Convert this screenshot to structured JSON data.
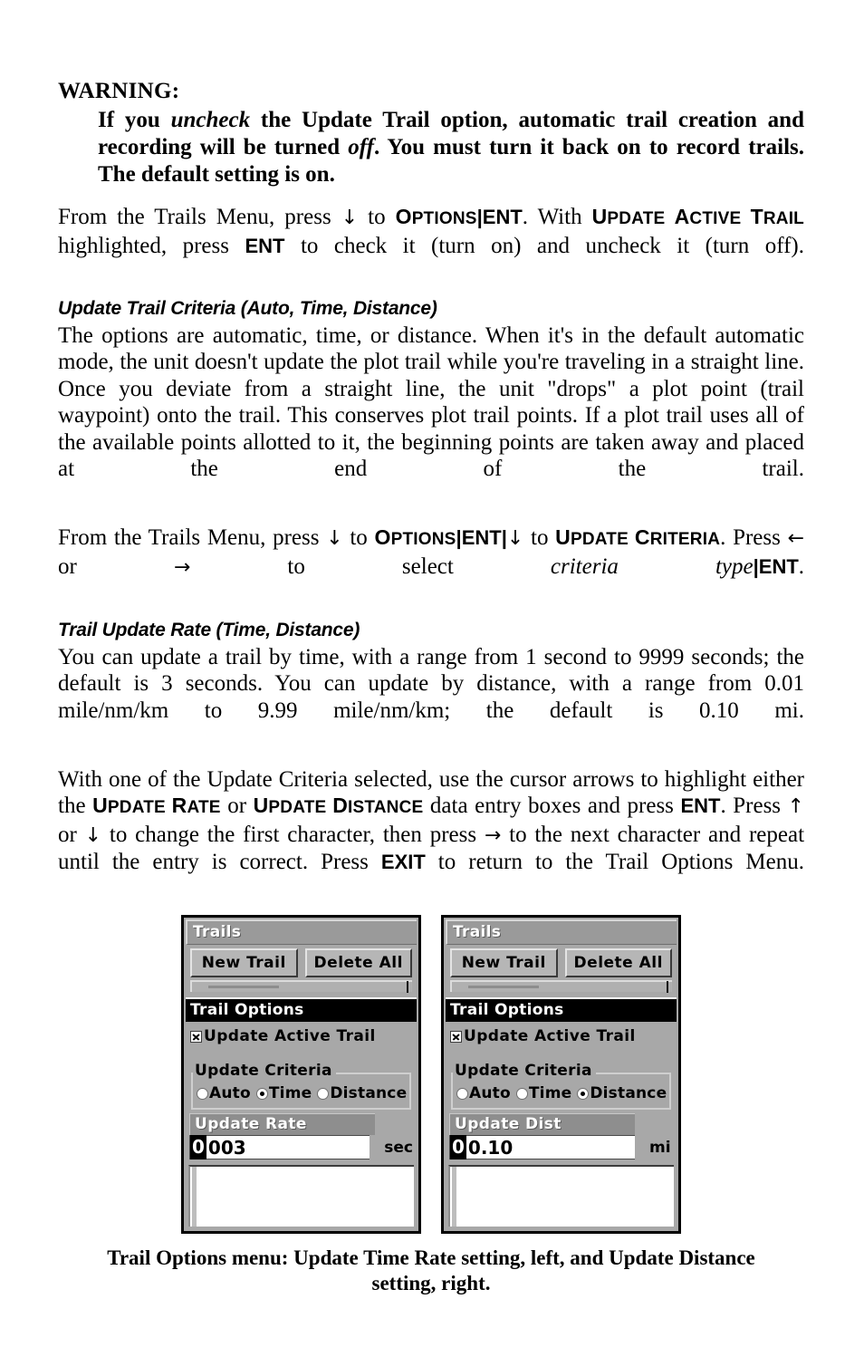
{
  "warning": {
    "title": "WARNING:",
    "line1_a": "If you ",
    "line1_italic": "uncheck",
    "line1_b": " the Update Trail option, automatic trail creation and recording will be turned ",
    "line1_italic2": "off",
    "line1_c": ". You must turn it back on to record trails. The default setting is on."
  },
  "para1": {
    "t1": "From the Trails Menu, press ",
    "arrow_down": "↓",
    "t2": " to ",
    "key_options_cap": "O",
    "key_options_rest": "PTIONS",
    "sep1": "|",
    "key_ent": "ENT",
    "t3": ". With ",
    "key_uat_1cap": "U",
    "key_uat_1rest": "PDATE ",
    "key_uat_2cap": "A",
    "key_uat_2rest": "CTIVE ",
    "key_uat_3cap": "T",
    "key_uat_3rest": "RAIL",
    "t4": " highlighted, press ",
    "key_ent2": "ENT",
    "t5": " to check it (turn on) and uncheck it (turn off)."
  },
  "subhead1": "Update Trail Criteria (Auto, Time, Distance)",
  "para2": "The options are automatic, time, or distance. When it's in the default automatic mode, the unit doesn't update the plot trail while you're traveling in a straight line. Once you deviate from a straight line, the unit \"drops\" a plot point (trail waypoint) onto the trail. This conserves plot trail points. If a plot trail uses all of the available points allotted to it, the beginning points are taken away and placed at the end of the trail.",
  "para3": {
    "t1": "From the Trails Menu, press ",
    "arrow_down": "↓",
    "t2": " to ",
    "key_options_cap": "O",
    "key_options_rest": "PTIONS",
    "sep1": "|",
    "key_ent": "ENT",
    "sep2": "|",
    "arrow_down2": "↓",
    "t3": " to ",
    "key_uc_1cap": "U",
    "key_uc_1rest": "PDATE ",
    "key_uc_2cap": "C",
    "key_uc_2rest": "RITERIA",
    "t4": ". Press ",
    "arrow_left": "←",
    "t5": " or ",
    "arrow_right": "→",
    "t6": " to select ",
    "italic_criteria": "criteria type",
    "sep3": "|",
    "key_ent2": "ENT",
    "t7": "."
  },
  "subhead2": "Trail Update Rate (Time, Distance)",
  "para4": "You can update a trail by time, with a range from 1 second to 9999 seconds; the default is 3 seconds. You can update by distance, with a range from 0.01 mile/nm/km to 9.99 mile/nm/km; the default is 0.10 mi.",
  "para5": {
    "t1": "With one of the Update Criteria selected, use the cursor arrows to highlight either the ",
    "key_ur_1cap": "U",
    "key_ur_1rest": "PDATE ",
    "key_ur_2cap": "R",
    "key_ur_2rest": "ATE",
    "t2": " or ",
    "key_ud_1cap": "U",
    "key_ud_1rest": "PDATE ",
    "key_ud_2cap": "D",
    "key_ud_2rest": "ISTANCE",
    "t3": " data entry boxes and press ",
    "key_ent": "ENT",
    "t4": ". Press ",
    "arrow_up": "↑",
    "t5": " or ",
    "arrow_down": "↓",
    "t6": " to change the first character, then press ",
    "arrow_right": "→",
    "t7": " to the next character and repeat until the entry is correct. Press ",
    "key_exit": "EXIT",
    "t8": " to return to the Trail Options Menu."
  },
  "figure": {
    "left_screen": {
      "window_title": "Trails",
      "button_new_trail": "New Trail",
      "button_delete_all": "Delete All",
      "dialog_title": "Trail Options",
      "checkbox_label": "Update Active Trail",
      "checkbox_checked": true,
      "criteria_legend": "Update Criteria",
      "radios": [
        {
          "label": "Auto",
          "selected": false
        },
        {
          "label": "Time",
          "selected": true
        },
        {
          "label": "Distance",
          "selected": false
        }
      ],
      "entry_header": "Update Rate",
      "entry_cursor_char": "0",
      "entry_value_rest": "003",
      "entry_unit": "sec"
    },
    "right_screen": {
      "window_title": "Trails",
      "button_new_trail": "New Trail",
      "button_delete_all": "Delete All",
      "dialog_title": "Trail Options",
      "checkbox_label": "Update Active Trail",
      "checkbox_checked": true,
      "criteria_legend": "Update Criteria",
      "radios": [
        {
          "label": "Auto",
          "selected": false
        },
        {
          "label": "Time",
          "selected": false
        },
        {
          "label": "Distance",
          "selected": true
        }
      ],
      "entry_header": "Update Dist",
      "entry_cursor_char": "0",
      "entry_value_rest": "0.10",
      "entry_unit": "mi"
    }
  },
  "caption": "Trail Options menu: Update Time Rate setting, left, and Update Distance setting, right.",
  "colors": {
    "screen_bg": "#a8a8a8",
    "title_bar": "#9a9a9a",
    "dialog_title_bar": "#000000",
    "entry_header_bar": "#8e8e8e",
    "field_bg": "#ffffff",
    "border": "#000000"
  }
}
